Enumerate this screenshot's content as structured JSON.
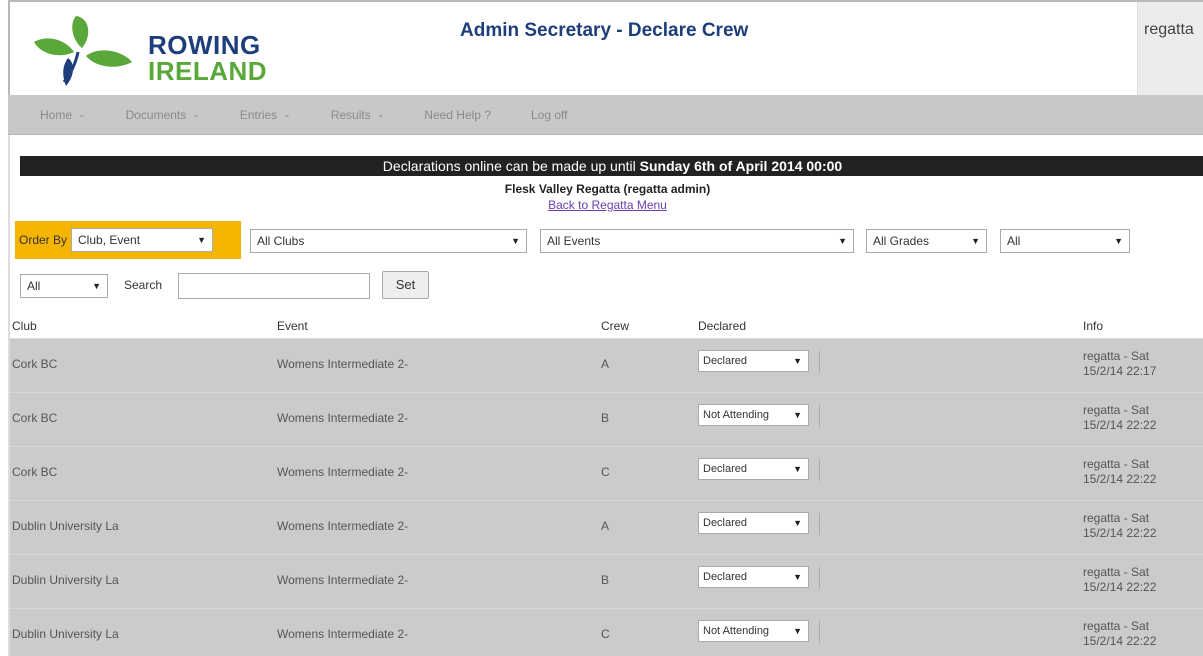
{
  "header": {
    "logo_line1": "ROWING",
    "logo_line2": "IRELAND",
    "title": "Admin Secretary - Declare Crew",
    "user": "regatta"
  },
  "nav": {
    "items": [
      {
        "label": "Home",
        "has_dropdown": true
      },
      {
        "label": "Documents",
        "has_dropdown": true
      },
      {
        "label": "Entries",
        "has_dropdown": true
      },
      {
        "label": "Results",
        "has_dropdown": true
      },
      {
        "label": "Need Help ?",
        "has_dropdown": false
      },
      {
        "label": "Log off",
        "has_dropdown": false
      }
    ]
  },
  "banner": {
    "text": "Declarations online can be made up until ",
    "deadline": "Sunday 6th of April 2014 00:00"
  },
  "regatta_name": "Flesk Valley Regatta (regatta admin)",
  "back_link": "Back to Regatta Menu",
  "filters": {
    "order_by_label": "Order By",
    "order_by_value": "Club, Event",
    "clubs": "All Clubs",
    "events": "All Events",
    "grades": "All Grades",
    "all1": "All",
    "all2": "All",
    "search_label": "Search",
    "search_value": "",
    "set_button": "Set"
  },
  "table": {
    "headers": {
      "club": "Club",
      "event": "Event",
      "crew": "Crew",
      "declared": "Declared",
      "info": "Info"
    },
    "rows": [
      {
        "club": "Cork BC",
        "event": "Womens Intermediate 2-",
        "crew": "A",
        "declared": "Declared",
        "info1": "regatta - Sat",
        "info2": "15/2/14 22:17"
      },
      {
        "club": "Cork BC",
        "event": "Womens Intermediate 2-",
        "crew": "B",
        "declared": "Not Attending",
        "info1": "regatta - Sat",
        "info2": "15/2/14 22:22"
      },
      {
        "club": "Cork BC",
        "event": "Womens Intermediate 2-",
        "crew": "C",
        "declared": "Declared",
        "info1": "regatta - Sat",
        "info2": "15/2/14 22:22"
      },
      {
        "club": "Dublin University La",
        "event": "Womens Intermediate 2-",
        "crew": "A",
        "declared": "Declared",
        "info1": "regatta - Sat",
        "info2": "15/2/14 22:22"
      },
      {
        "club": "Dublin University La",
        "event": "Womens Intermediate 2-",
        "crew": "B",
        "declared": "Declared",
        "info1": "regatta - Sat",
        "info2": "15/2/14 22:22"
      },
      {
        "club": "Dublin University La",
        "event": "Womens Intermediate 2-",
        "crew": "C",
        "declared": "Not Attending",
        "info1": "regatta - Sat",
        "info2": "15/2/14 22:22"
      }
    ]
  },
  "colors": {
    "brand_blue": "#1d3e7a",
    "brand_green": "#5aa83a",
    "order_by_highlight": "#f5b400",
    "banner_bg": "#222222",
    "row_bg": "#cbcbcb"
  }
}
